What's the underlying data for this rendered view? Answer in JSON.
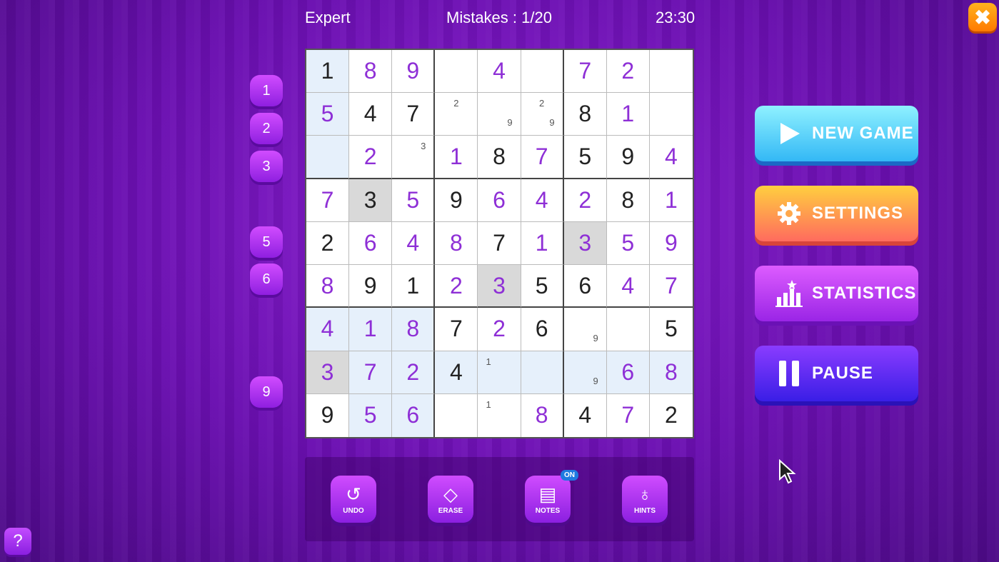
{
  "header": {
    "difficulty": "Expert",
    "mistakes": "Mistakes : 1/20",
    "timer": "23:30"
  },
  "close_glyph": "✖",
  "counters": [
    "1",
    "2",
    "3",
    "",
    "5",
    "6",
    "",
    "",
    "9"
  ],
  "grid": [
    [
      {
        "v": "1",
        "p": 0,
        "c": "hl"
      },
      {
        "v": "8",
        "p": 1
      },
      {
        "v": "9",
        "p": 1
      },
      {
        "v": ""
      },
      {
        "v": "4",
        "p": 1
      },
      {
        "v": ""
      },
      {
        "v": "7",
        "p": 1
      },
      {
        "v": "2",
        "p": 1
      },
      {
        "v": ""
      }
    ],
    [
      {
        "v": "5",
        "p": 1,
        "c": "hl"
      },
      {
        "v": "4",
        "p": 0
      },
      {
        "v": "7",
        "p": 0
      },
      {
        "v": "",
        "n": [
          [
            "2",
            "tc"
          ]
        ]
      },
      {
        "v": "",
        "n": [
          [
            "9",
            "br"
          ]
        ]
      },
      {
        "v": "",
        "n": [
          [
            "2",
            "tc"
          ],
          [
            "9",
            "br"
          ]
        ]
      },
      {
        "v": "8",
        "p": 0
      },
      {
        "v": "1",
        "p": 1
      },
      {
        "v": ""
      }
    ],
    [
      {
        "v": "",
        "c": "hl"
      },
      {
        "v": "2",
        "p": 1
      },
      {
        "v": "",
        "n": [
          [
            "3",
            "tr"
          ]
        ]
      },
      {
        "v": "1",
        "p": 1
      },
      {
        "v": "8",
        "p": 0
      },
      {
        "v": "7",
        "p": 1
      },
      {
        "v": "5",
        "p": 0
      },
      {
        "v": "9",
        "p": 0
      },
      {
        "v": "4",
        "p": 1
      }
    ],
    [
      {
        "v": "7",
        "p": 1
      },
      {
        "v": "3",
        "p": 0,
        "c": "same"
      },
      {
        "v": "5",
        "p": 1
      },
      {
        "v": "9",
        "p": 0
      },
      {
        "v": "6",
        "p": 1
      },
      {
        "v": "4",
        "p": 1
      },
      {
        "v": "2",
        "p": 1
      },
      {
        "v": "8",
        "p": 0
      },
      {
        "v": "1",
        "p": 1
      }
    ],
    [
      {
        "v": "2",
        "p": 0
      },
      {
        "v": "6",
        "p": 1
      },
      {
        "v": "4",
        "p": 1
      },
      {
        "v": "8",
        "p": 1
      },
      {
        "v": "7",
        "p": 0
      },
      {
        "v": "1",
        "p": 1
      },
      {
        "v": "3",
        "p": 1,
        "c": "same"
      },
      {
        "v": "5",
        "p": 1
      },
      {
        "v": "9",
        "p": 1
      }
    ],
    [
      {
        "v": "8",
        "p": 1
      },
      {
        "v": "9",
        "p": 0
      },
      {
        "v": "1",
        "p": 0
      },
      {
        "v": "2",
        "p": 1
      },
      {
        "v": "3",
        "p": 1,
        "c": "same"
      },
      {
        "v": "5",
        "p": 0
      },
      {
        "v": "6",
        "p": 0
      },
      {
        "v": "4",
        "p": 1
      },
      {
        "v": "7",
        "p": 1
      }
    ],
    [
      {
        "v": "4",
        "p": 1,
        "c": "hl"
      },
      {
        "v": "1",
        "p": 1,
        "c": "hl"
      },
      {
        "v": "8",
        "p": 1,
        "c": "hl"
      },
      {
        "v": "7",
        "p": 0
      },
      {
        "v": "2",
        "p": 1
      },
      {
        "v": "6",
        "p": 0
      },
      {
        "v": "",
        "n": [
          [
            "9",
            "br"
          ]
        ]
      },
      {
        "v": ""
      },
      {
        "v": "5",
        "p": 0
      }
    ],
    [
      {
        "v": "3",
        "p": 1,
        "c": "same"
      },
      {
        "v": "7",
        "p": 1,
        "c": "hl"
      },
      {
        "v": "2",
        "p": 1,
        "c": "hl"
      },
      {
        "v": "4",
        "p": 0,
        "c": "hl"
      },
      {
        "v": "",
        "c": "hl",
        "n": [
          [
            "1",
            "tl"
          ]
        ]
      },
      {
        "v": "",
        "c": "hl"
      },
      {
        "v": "",
        "c": "hl",
        "n": [
          [
            "9",
            "br"
          ]
        ]
      },
      {
        "v": "6",
        "p": 1,
        "c": "hl"
      },
      {
        "v": "8",
        "p": 1,
        "c": "hl"
      }
    ],
    [
      {
        "v": "9",
        "p": 0
      },
      {
        "v": "5",
        "p": 1,
        "c": "hl"
      },
      {
        "v": "6",
        "p": 1,
        "c": "hl"
      },
      {
        "v": ""
      },
      {
        "v": "",
        "n": [
          [
            "1",
            "tl"
          ]
        ]
      },
      {
        "v": "8",
        "p": 1
      },
      {
        "v": "4",
        "p": 0
      },
      {
        "v": "7",
        "p": 1
      },
      {
        "v": "2",
        "p": 0
      }
    ]
  ],
  "tools": [
    {
      "label": "UNDO",
      "icon": "undo-icon",
      "glyph": "↺"
    },
    {
      "label": "ERASE",
      "icon": "eraser-icon",
      "glyph": "◇"
    },
    {
      "label": "NOTES",
      "icon": "notes-icon",
      "glyph": "▤"
    },
    {
      "label": "HINTS",
      "icon": "lightbulb-icon",
      "glyph": "♁"
    }
  ],
  "notes_badge": "ON",
  "menu": {
    "new_game": "NEW GAME",
    "settings": "SETTINGS",
    "statistics": "STATISTICS",
    "pause": "PAUSE"
  },
  "help_glyph": "?"
}
